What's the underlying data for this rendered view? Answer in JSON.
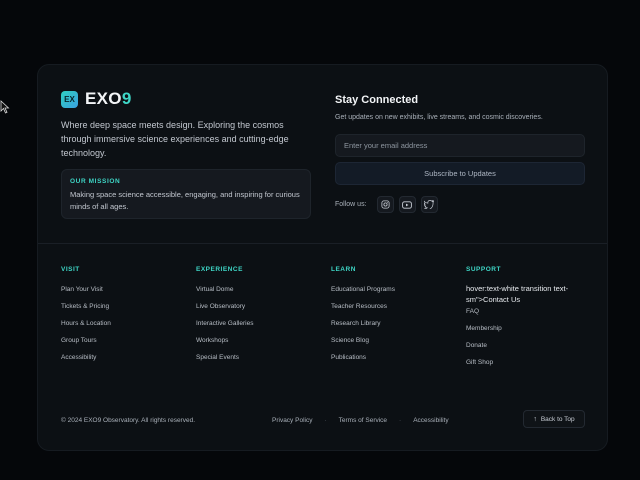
{
  "brand": {
    "logo_text": "EX",
    "name_main": "EXO",
    "name_accent": "9"
  },
  "intro": {
    "description": "Where deep space meets design. Exploring the cosmos through immersive science experiences and cutting-edge technology."
  },
  "mission": {
    "title": "OUR MISSION",
    "text": "Making space science accessible, engaging, and inspiring for curious minds of all ages."
  },
  "newsletter": {
    "title": "Stay Connected",
    "subtitle": "Get updates on new exhibits, live streams, and cosmic discoveries.",
    "email_placeholder": "Enter your email address",
    "subscribe_label": "Subscribe to Updates",
    "follow_label": "Follow us:"
  },
  "social_icons": [
    "instagram-icon",
    "youtube-icon",
    "twitter-icon"
  ],
  "columns": {
    "visit": {
      "title": "VISIT",
      "links": [
        "Plan Your Visit",
        "Tickets & Pricing",
        "Hours & Location",
        "Group Tours",
        "Accessibility"
      ]
    },
    "experience": {
      "title": "EXPERIENCE",
      "links": [
        "Virtual Dome",
        "Live Observatory",
        "Interactive Galleries",
        "Workshops",
        "Special Events"
      ]
    },
    "learn": {
      "title": "LEARN",
      "links": [
        "Educational Programs",
        "Teacher Resources",
        "Research Library",
        "Science Blog",
        "Publications"
      ]
    },
    "support": {
      "title": "SUPPORT",
      "odd_text": "hover:text-white transition text-sm\">Contact Us",
      "links": [
        "FAQ",
        "Membership",
        "Donate",
        "Gift Shop"
      ]
    }
  },
  "footer": {
    "copyright": "© 2024 EXO9 Observatory. All rights reserved.",
    "privacy": "Privacy Policy",
    "terms": "Terms of Service",
    "accessibility": "Accessibility",
    "separator": "·",
    "back_to_top": "Back to Top"
  },
  "colors": {
    "accent": "#3ed6c6",
    "background": "#05070a",
    "card": "#0c1014"
  }
}
